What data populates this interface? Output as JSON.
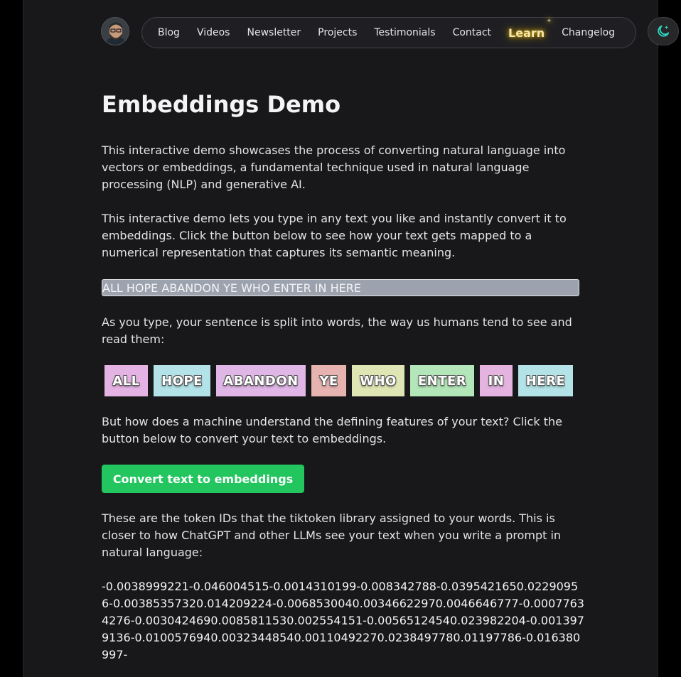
{
  "nav": {
    "items": [
      {
        "label": "Blog",
        "name": "nav-blog"
      },
      {
        "label": "Videos",
        "name": "nav-videos"
      },
      {
        "label": "Newsletter",
        "name": "nav-newsletter"
      },
      {
        "label": "Projects",
        "name": "nav-projects"
      },
      {
        "label": "Testimonials",
        "name": "nav-testimonials"
      },
      {
        "label": "Contact",
        "name": "nav-contact"
      },
      {
        "label": "Learn",
        "name": "nav-learn"
      },
      {
        "label": "Changelog",
        "name": "nav-changelog"
      }
    ],
    "theme_icon": "moon-sparkle-icon",
    "learn_highlight_color": "#e6b800"
  },
  "main": {
    "title": "Embeddings Demo",
    "intro_1": "This interactive demo showcases the process of converting natural language into vectors or embeddings, a fundamental technique used in natural language processing (NLP) and generative AI.",
    "intro_2": "This interactive demo lets you type in any text you like and instantly convert it to embeddings. Click the button below to see how your text gets mapped to a numerical representation that captures its semantic meaning.",
    "input_value": "ALL HOPE ABANDON YE WHO ENTER IN HERE",
    "split_text": "As you type, your sentence is split into words, the way us humans tend to see and read them:",
    "tokens": [
      {
        "word": "ALL",
        "color": "#e5b3e3"
      },
      {
        "word": "HOPE",
        "color": "#b3e3e8"
      },
      {
        "word": "ABANDON",
        "color": "#e0b6e6"
      },
      {
        "word": "YE",
        "color": "#e6b3b0"
      },
      {
        "word": "WHO",
        "color": "#dfe6b3"
      },
      {
        "word": "ENTER",
        "color": "#b3e6b8"
      },
      {
        "word": "IN",
        "color": "#e5b3e0"
      },
      {
        "word": "HERE",
        "color": "#b3e3e6"
      }
    ],
    "question_text": "But how does a machine understand the defining features of your text? Click the button below to convert your text to embeddings.",
    "convert_button": "Convert text to embeddings",
    "token_ids_text": "These are the token IDs that the tiktoken library assigned to your words. This is closer to how ChatGPT and other LLMs see your text when you write a prompt in natural language:",
    "embeddings_output": "-0.0038999221-0.046004515-0.0014310199-0.008342788-0.0395421650.02290956-0.00385357320.014209224-0.0068530040.00346622970.0046646777-0.00077634276-0.0030424690.0085811530.002554151-0.00565124540.023982204-0.0013979136-0.0100576940.00323448540.00110492270.0238497780.01197786-0.016380997-"
  }
}
